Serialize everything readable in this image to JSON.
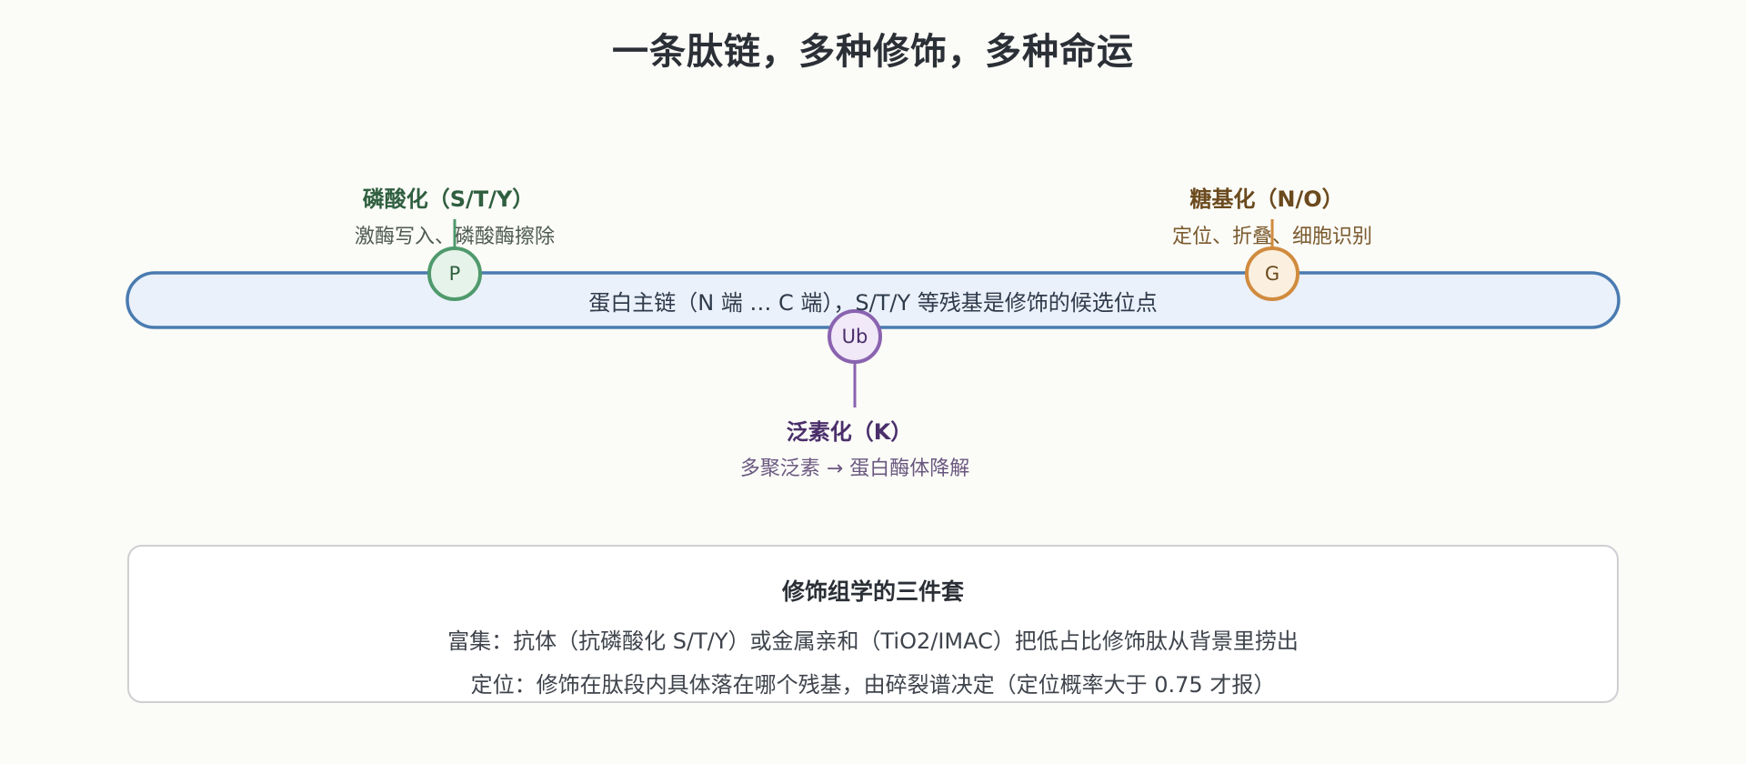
{
  "title": "一条肽链，多种修饰，多种命运",
  "backbone": {
    "label": "蛋白主链（N 端 … C 端），S/T/Y 等残基是修饰的候选位点",
    "fill": "#eaf1fb",
    "stroke": "#4a7bb0"
  },
  "modifications": [
    {
      "id": "phospho",
      "symbol": "P",
      "title": "磷酸化（S/T/Y）",
      "desc": "激酶写入、磷酸酶擦除",
      "title_color": "#2f5f3f",
      "desc_color": "#4e5a52",
      "fill": "#e6f3ea",
      "stroke": "#4f9a6c"
    },
    {
      "id": "glyco",
      "symbol": "G",
      "title": "糖基化（N/O）",
      "desc": "定位、折叠、细胞识别",
      "title_color": "#6b4a1e",
      "desc_color": "#7a5a2e",
      "fill": "#fbf0df",
      "stroke": "#d18b3e"
    },
    {
      "id": "ubiq",
      "symbol": "Ub",
      "title": "泛素化（K）",
      "desc": "多聚泛素 → 蛋白酶体降解",
      "title_color": "#4a2f6b",
      "desc_color": "#6a5880",
      "fill": "#f1e8f8",
      "stroke": "#8a63b0"
    }
  ],
  "info": {
    "title": "修饰组学的三件套",
    "lines": [
      "富集：抗体（抗磷酸化 S/T/Y）或金属亲和（TiO2/IMAC）把低占比修饰肽从背景里捞出",
      "定位：修饰在肽段内具体落在哪个残基，由碎裂谱决定（定位概率大于 0.75 才报）"
    ]
  }
}
